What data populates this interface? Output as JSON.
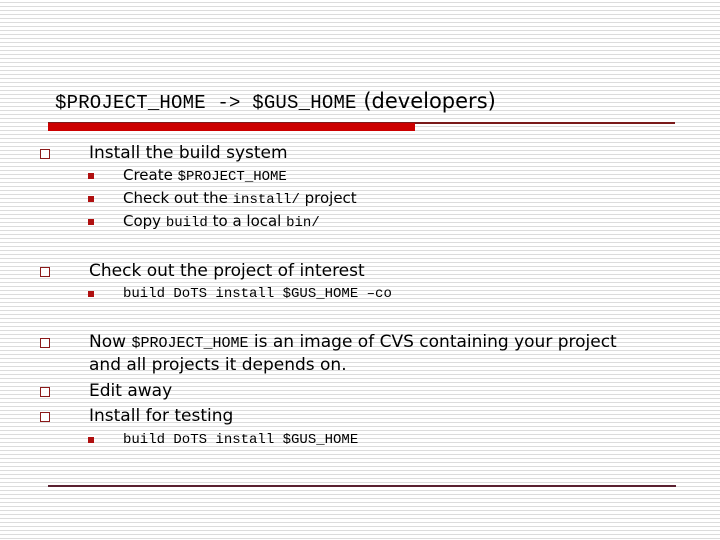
{
  "slide": {
    "title": {
      "code_part": "$PROJECT_HOME -> $GUS_HOME",
      "text_part": " (developers)"
    },
    "colors": {
      "accent_bar": "#cc0000",
      "bullet": "#b01010",
      "rule": "#7a1a1a"
    },
    "bullets": [
      {
        "text": "Install the build system",
        "sub": [
          {
            "pre": "Create ",
            "code": "$PROJECT_HOME",
            "post": ""
          },
          {
            "pre": "Check out the ",
            "code": "install/",
            "post": " project"
          },
          {
            "pre": "Copy ",
            "code": "build",
            "post": " to a local ",
            "code2": "bin/"
          }
        ]
      },
      {
        "text": "Check out the project of interest",
        "sub": [
          {
            "code": "build DoTS install $GUS_HOME –co"
          }
        ]
      },
      {
        "pre": "Now ",
        "code": "$PROJECT_HOME",
        "post": " is an image of CVS containing your project",
        "line2": "and all projects it depends on."
      },
      {
        "text": "Edit away"
      },
      {
        "text": "Install for testing",
        "sub": [
          {
            "code": "build DoTS install $GUS_HOME"
          }
        ]
      }
    ]
  }
}
